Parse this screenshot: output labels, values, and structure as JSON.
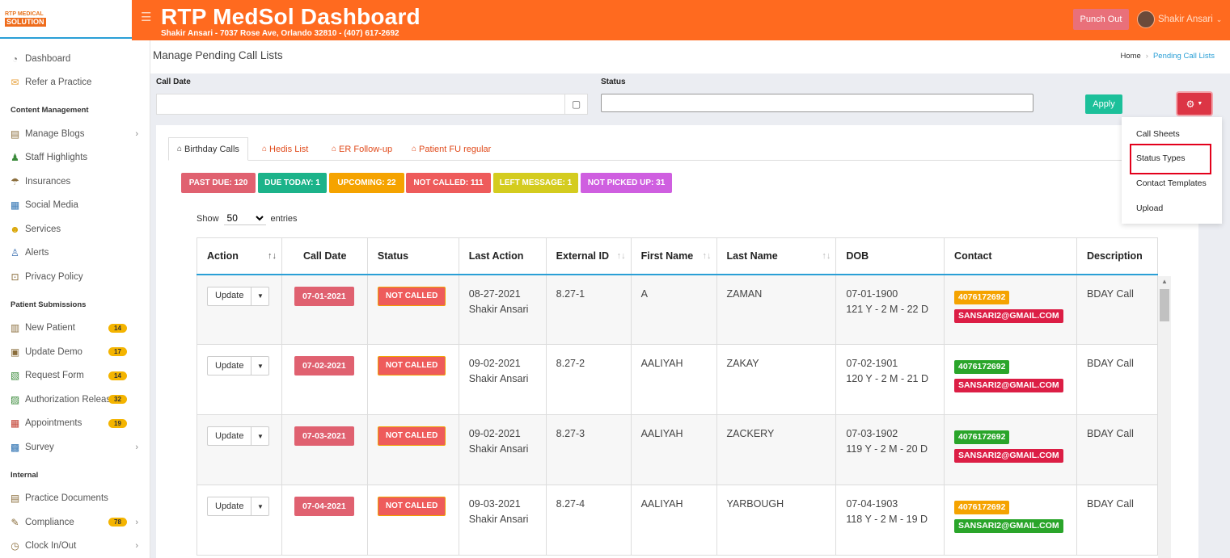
{
  "sidebar": {
    "logo_line1": "RTP MEDICAL",
    "logo_line2": "SOLUTION",
    "items_top": [
      {
        "label": "Dashboard",
        "icon": "dashboard-icon"
      },
      {
        "label": "Refer a Practice",
        "icon": "envelope-icon"
      }
    ],
    "section1": "Content Management",
    "items_content": [
      {
        "label": "Manage Blogs"
      },
      {
        "label": "Staff Highlights"
      },
      {
        "label": "Insurances"
      },
      {
        "label": "Social Media"
      },
      {
        "label": "Services"
      },
      {
        "label": "Alerts"
      },
      {
        "label": "Privacy Policy"
      }
    ],
    "section2": "Patient Submissions",
    "items_patient": [
      {
        "label": "New Patient",
        "badge": "14"
      },
      {
        "label": "Update Demo",
        "badge": "17"
      },
      {
        "label": "Request Form",
        "badge": "14"
      },
      {
        "label": "Authorization Release",
        "badge": "32"
      },
      {
        "label": "Appointments",
        "badge": "19"
      },
      {
        "label": "Survey"
      }
    ],
    "section3": "Internal",
    "items_internal": [
      {
        "label": "Practice Documents"
      },
      {
        "label": "Compliance",
        "badge": "78"
      },
      {
        "label": "Clock In/Out"
      }
    ]
  },
  "header": {
    "title": "RTP MedSol Dashboard",
    "subtitle": "Shakir Ansari - 7037 Rose Ave, Orlando 32810 - (407) 617-2692",
    "punch_out": "Punch Out",
    "user_name": "Shakir Ansari",
    "brand_color": "#ff6a1f"
  },
  "page": {
    "title": "Manage Pending Call Lists",
    "breadcrumb_home": "Home",
    "breadcrumb_current": "Pending Call Lists"
  },
  "filters": {
    "call_date_label": "Call Date",
    "call_date_value": "",
    "status_label": "Status",
    "status_value": "",
    "apply": "Apply"
  },
  "settings_menu": {
    "items": [
      "Call Sheets",
      "Status Types",
      "Contact Templates",
      "Upload"
    ],
    "highlighted": "Status Types"
  },
  "tabs": [
    "Birthday Calls",
    "Hedis List",
    "ER Follow-up",
    "Patient FU regular"
  ],
  "active_tab": "Birthday Calls",
  "status_pills": [
    {
      "label": "PAST DUE: 120",
      "color": "#e06170"
    },
    {
      "label": "DUE TODAY: 1",
      "color": "#1cb38a"
    },
    {
      "label": "UPCOMING: 22",
      "color": "#f5a300"
    },
    {
      "label": "NOT CALLED: 111",
      "color": "#ee5b5b"
    },
    {
      "label": "LEFT MESSAGE: 1",
      "color": "#d4cc1f"
    },
    {
      "label": "NOT PICKED UP: 31",
      "color": "#cf5fe0"
    }
  ],
  "entries": {
    "show": "Show",
    "value": "50",
    "suffix": "entries"
  },
  "table": {
    "columns": [
      "Action",
      "Call Date",
      "Status",
      "Last Action",
      "External ID",
      "First Name",
      "Last Name",
      "DOB",
      "Contact",
      "Description"
    ],
    "rows": [
      {
        "action": "Update",
        "call_date": "07-01-2021",
        "status": "NOT CALLED",
        "last_action_date": "08-27-2021",
        "last_action_by": "Shakir Ansari",
        "external_id": "8.27-1",
        "first_name": "A",
        "last_name": "ZAMAN",
        "dob": "07-01-1900",
        "age": "121 Y - 2 M - 22 D",
        "phone": "4076172692",
        "phone_color": "#f5a300",
        "email": "SANSARI2@GMAIL.COM",
        "email_color": "#dc1e45",
        "description": "BDAY Call"
      },
      {
        "action": "Update",
        "call_date": "07-02-2021",
        "status": "NOT CALLED",
        "last_action_date": "09-02-2021",
        "last_action_by": "Shakir Ansari",
        "external_id": "8.27-2",
        "first_name": "AALIYAH",
        "last_name": "ZAKAY",
        "dob": "07-02-1901",
        "age": "120 Y - 2 M - 21 D",
        "phone": "4076172692",
        "phone_color": "#2aa52a",
        "email": "SANSARI2@GMAIL.COM",
        "email_color": "#dc1e45",
        "description": "BDAY Call"
      },
      {
        "action": "Update",
        "call_date": "07-03-2021",
        "status": "NOT CALLED",
        "last_action_date": "09-02-2021",
        "last_action_by": "Shakir Ansari",
        "external_id": "8.27-3",
        "first_name": "AALIYAH",
        "last_name": "ZACKERY",
        "dob": "07-03-1902",
        "age": "119 Y - 2 M - 20 D",
        "phone": "4076172692",
        "phone_color": "#2aa52a",
        "email": "SANSARI2@GMAIL.COM",
        "email_color": "#dc1e45",
        "description": "BDAY Call"
      },
      {
        "action": "Update",
        "call_date": "07-04-2021",
        "status": "NOT CALLED",
        "last_action_date": "09-03-2021",
        "last_action_by": "Shakir Ansari",
        "external_id": "8.27-4",
        "first_name": "AALIYAH",
        "last_name": "YARBOUGH",
        "dob": "07-04-1903",
        "age": "118 Y - 2 M - 19 D",
        "phone": "4076172692",
        "phone_color": "#f5a300",
        "email": "SANSARI2@GMAIL.COM",
        "email_color": "#2aa52a",
        "description": "BDAY Call"
      }
    ]
  }
}
